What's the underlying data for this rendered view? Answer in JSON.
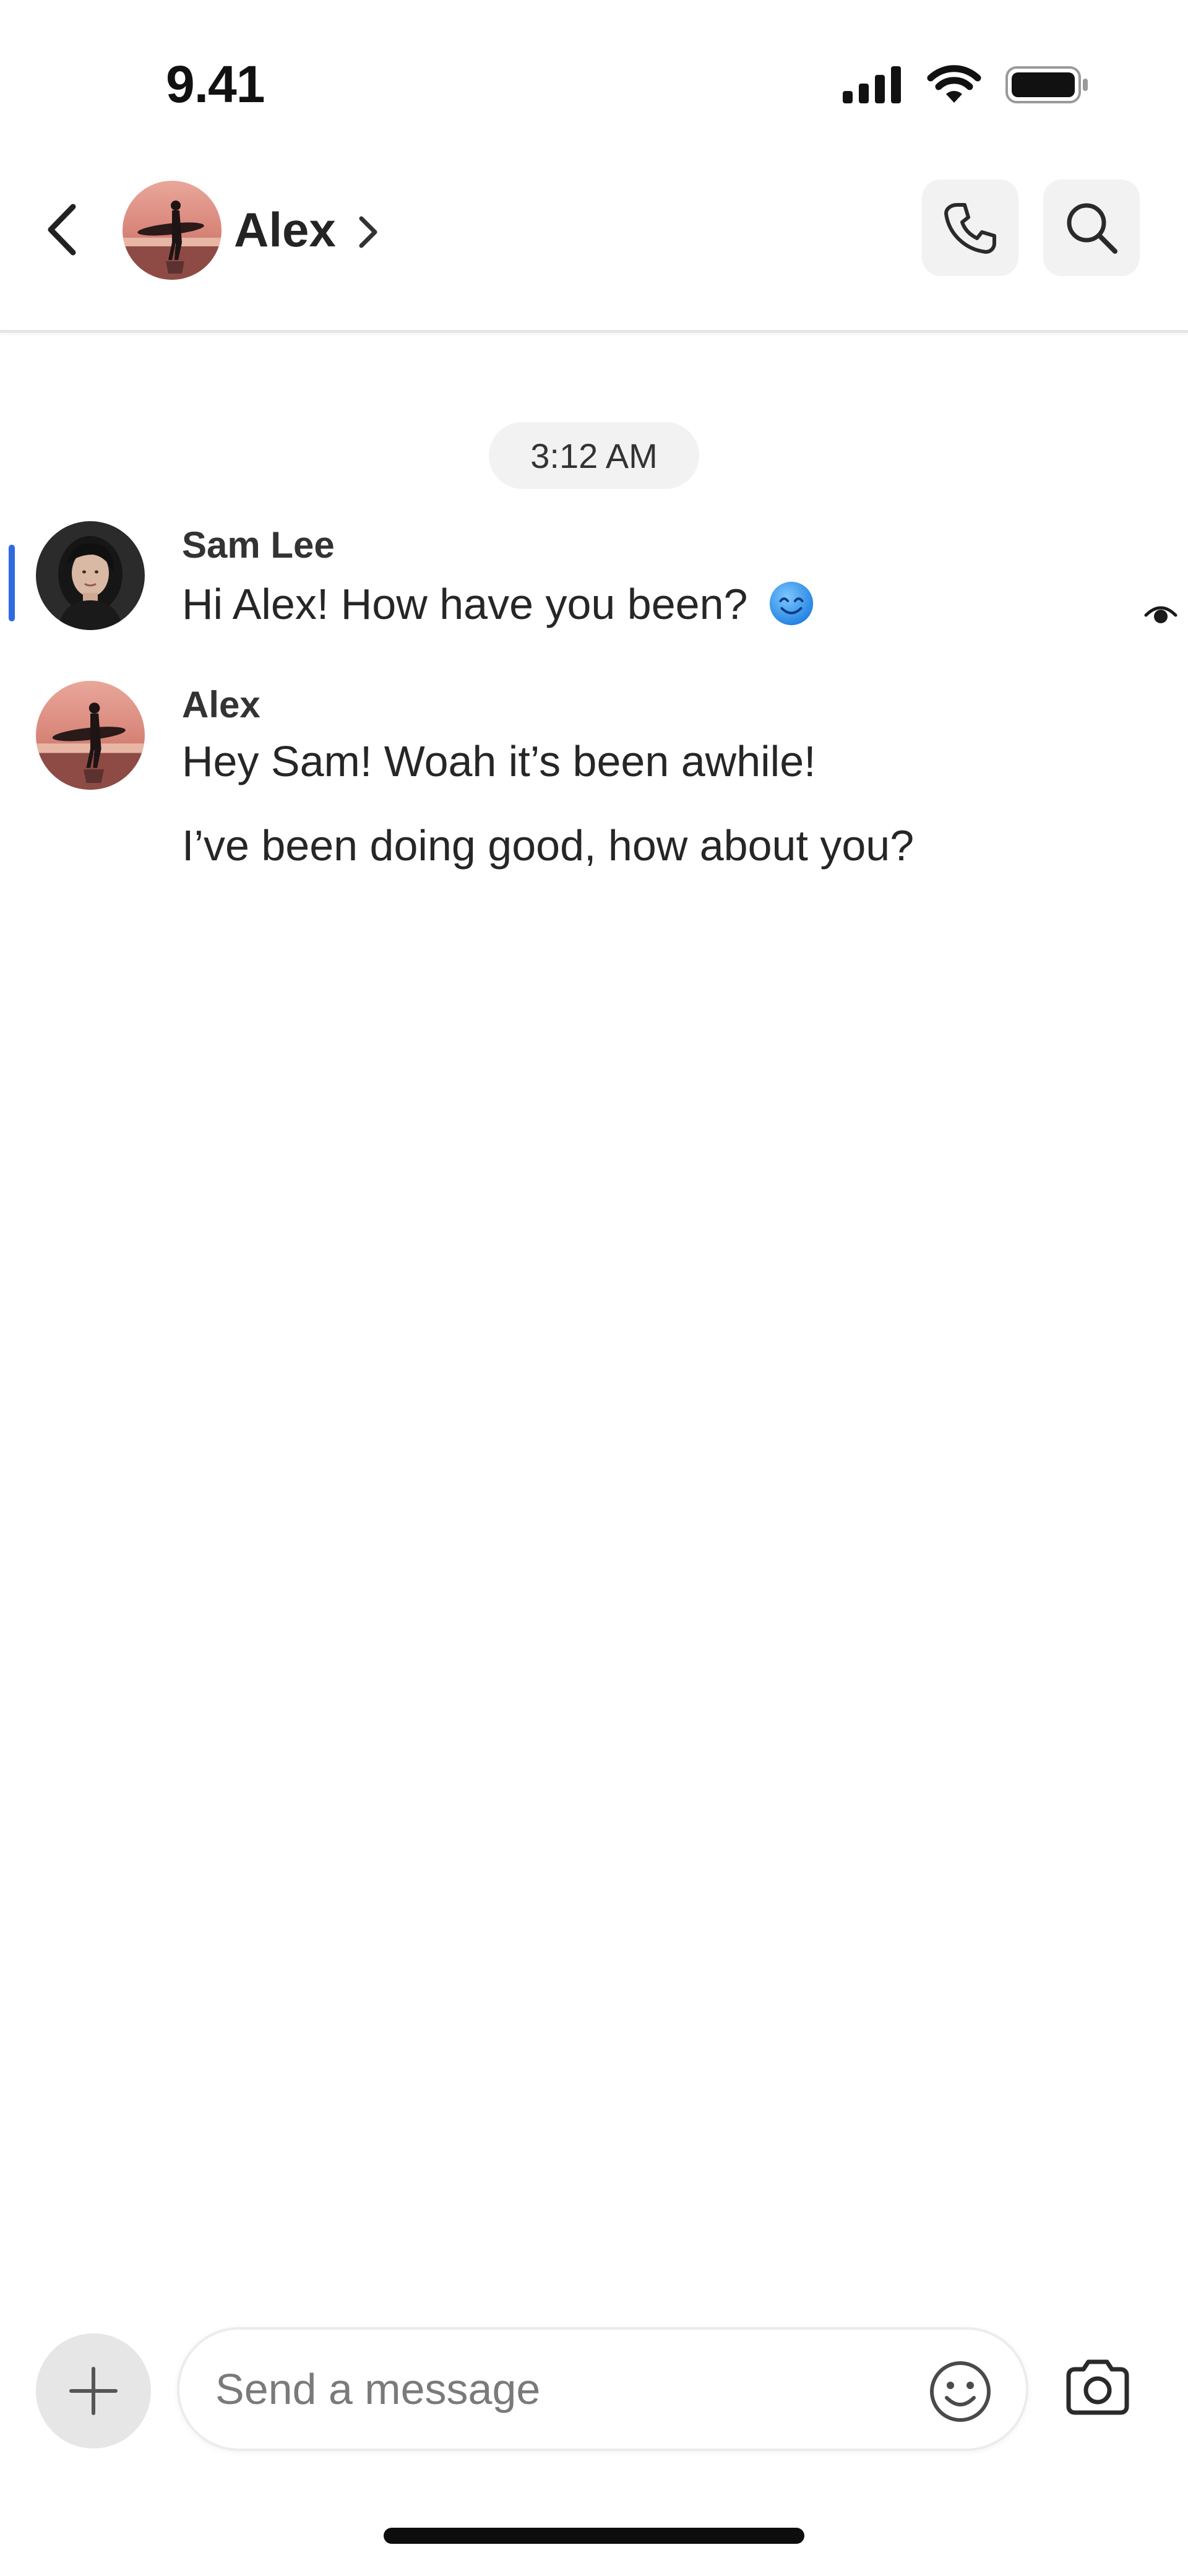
{
  "status_bar": {
    "time": "9.41",
    "icons": [
      "cellular-signal-icon",
      "wifi-icon",
      "battery-icon"
    ]
  },
  "header": {
    "contact_name": "Alex",
    "icons": {
      "back": "chevron-left-icon",
      "profile": "chevron-right-icon",
      "call": "phone-icon",
      "search": "search-icon"
    }
  },
  "conversation": {
    "timestamp": "3:12 AM",
    "messages": [
      {
        "sender": "Sam Lee",
        "lines": [
          "Hi Alex! How have you been?"
        ],
        "emoji": "smiling-face-emoji",
        "unread_marker": true,
        "seen_indicator": "eye-icon"
      },
      {
        "sender": "Alex",
        "lines": [
          "Hey Sam! Woah it’s been awhile!",
          "I’ve been doing good, how about you?"
        ]
      }
    ]
  },
  "composer": {
    "placeholder": "Send a message",
    "value": "",
    "icons": {
      "add": "plus-icon",
      "emoji": "smiley-icon",
      "camera": "camera-icon"
    }
  },
  "colors": {
    "accent": "#2f6be0",
    "button_bg": "#f2f2f2",
    "divider": "#e6e6e6"
  }
}
